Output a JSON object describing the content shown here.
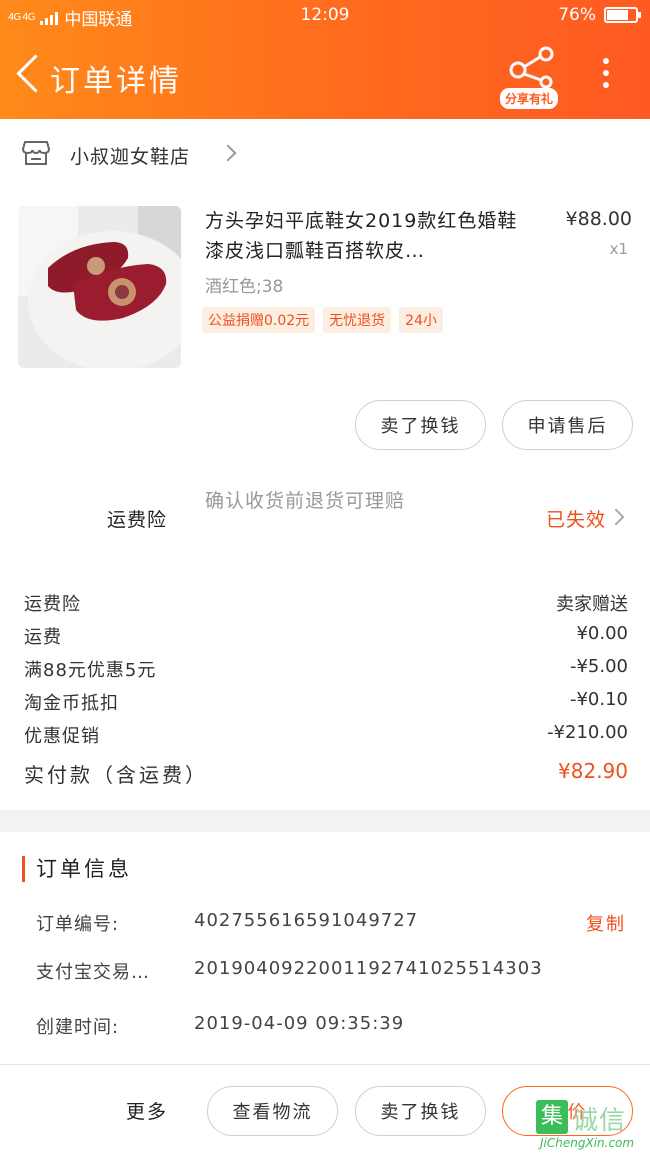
{
  "status_bar": {
    "network": "4G 4G",
    "carrier": "中国联通",
    "time": "12:09",
    "battery_text": "76%",
    "battery_level": 0.76
  },
  "nav": {
    "title": "订单详情",
    "share_label": "分享有礼"
  },
  "store": {
    "name": "小叔迦女鞋店"
  },
  "product": {
    "title": "方头孕妇平底鞋女2019款红色婚鞋漆皮浅口瓢鞋百搭软皮…",
    "price": "¥88.00",
    "quantity": "x1",
    "spec": "酒红色;38",
    "tags": [
      "公益捐赠0.02元",
      "无忧退货",
      "24小"
    ]
  },
  "item_actions": {
    "refund": "卖了换钱",
    "after_sale": "申请售后"
  },
  "insurance": {
    "label": "运费险",
    "description": "确认收货前退货可理赔",
    "status": "已失效"
  },
  "costs": [
    {
      "label": "运费险",
      "value": "卖家赠送"
    },
    {
      "label": "运费",
      "value": "¥0.00"
    },
    {
      "label": "满88元优惠5元",
      "value": "-¥5.00"
    },
    {
      "label": "淘金币抵扣",
      "value": "-¥0.10"
    },
    {
      "label": "优惠促销",
      "value": "-¥210.00"
    },
    {
      "label": "实付款（含运费）",
      "value": "¥82.90"
    }
  ],
  "order_info": {
    "title": "订单信息",
    "rows": [
      {
        "key": "订单编号:",
        "value": "402755616591049727"
      },
      {
        "key": "支付宝交易…",
        "value": "2019040922001192741025514303"
      },
      {
        "key": "创建时间:",
        "value": "2019-04-09 09:35:39"
      }
    ],
    "copy_label": "复制"
  },
  "bottom_bar": {
    "more": "更多",
    "logistics": "查看物流",
    "sell": "卖了换钱",
    "review": "评价"
  },
  "watermark": {
    "logo": "集",
    "text": "诚信",
    "sub": "JiChengXin.com"
  },
  "colors": {
    "brand_orange": "#ff6a1e",
    "price_red": "#f0501e"
  }
}
